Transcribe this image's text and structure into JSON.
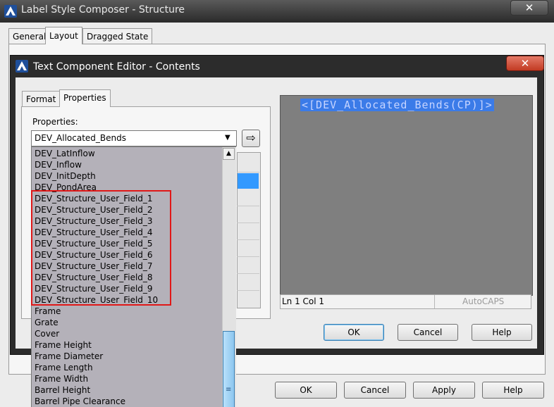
{
  "outer": {
    "title": "Label Style Composer - Structure",
    "close_glyph": "✕",
    "tabs": [
      "General",
      "Layout",
      "Dragged State"
    ],
    "buttons": {
      "ok": "OK",
      "cancel": "Cancel",
      "apply": "Apply",
      "help": "Help"
    }
  },
  "inner": {
    "title": "Text Component Editor - Contents",
    "close_glyph": "✕",
    "tabs": [
      "Format",
      "Properties"
    ],
    "properties_label": "Properties:",
    "selected_property": "DEV_Allocated_Bends",
    "insert_arrow": "⇨",
    "preview_text": "<[DEV_Allocated_Bends(CP)]>",
    "status": {
      "position": "Ln 1 Col 1",
      "mode": "AutoCAPS"
    },
    "buttons": {
      "ok": "OK",
      "cancel": "Cancel",
      "help": "Help"
    }
  },
  "dropdown": {
    "items": [
      "DEV_LatInflow",
      "DEV_Inflow",
      "DEV_InitDepth",
      "DEV_PondArea",
      "DEV_Structure_User_Field_1",
      "DEV_Structure_User_Field_2",
      "DEV_Structure_User_Field_3",
      "DEV_Structure_User_Field_4",
      "DEV_Structure_User_Field_5",
      "DEV_Structure_User_Field_6",
      "DEV_Structure_User_Field_7",
      "DEV_Structure_User_Field_8",
      "DEV_Structure_User_Field_9",
      "DEV_Structure_User_Field_10",
      "Frame",
      "Grate",
      "Cover",
      "Frame Height",
      "Frame Diameter",
      "Frame Length",
      "Frame Width",
      "Barrel Height",
      "Barrel Pipe Clearance"
    ],
    "scroll_up_glyph": "▲",
    "thumb_grip_glyph": "≡"
  },
  "colors": {
    "highlight_box": "#e01818",
    "selection": "#3399ff",
    "list_bg": "#b4b1b9"
  }
}
